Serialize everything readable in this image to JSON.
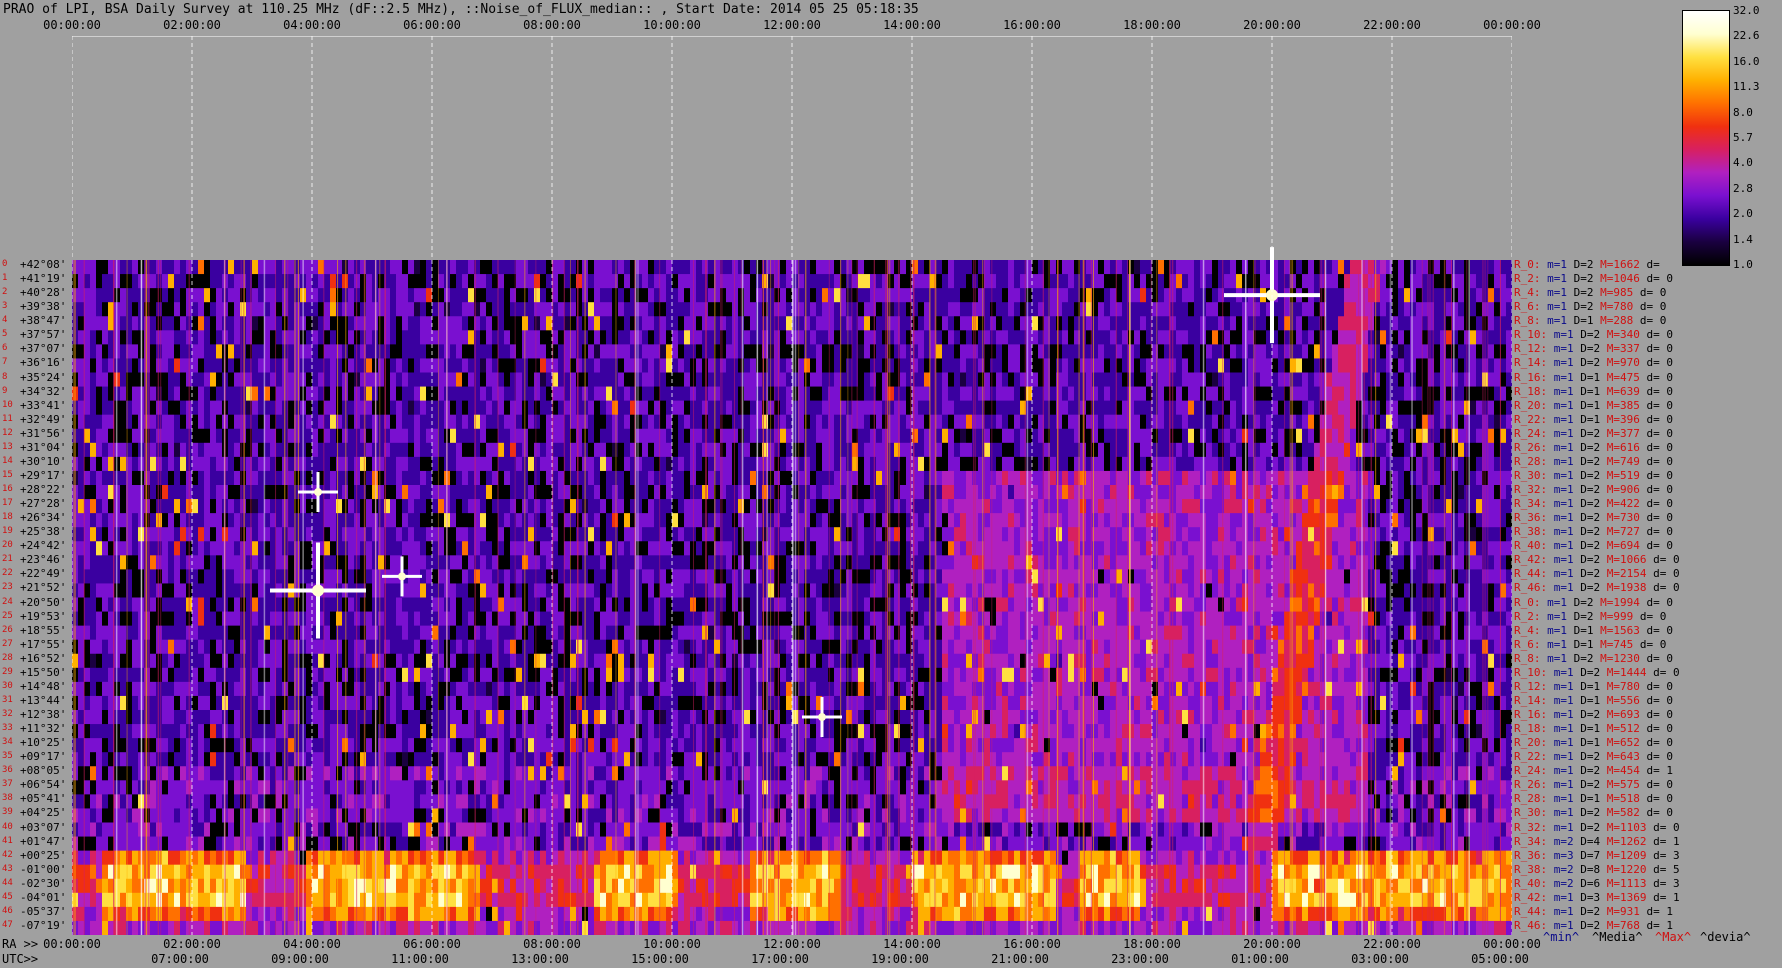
{
  "title": "PRAO of LPI, BSA Daily Survey at 110.25 MHz (dF::2.5 MHz), ::Noise_of_FLUX_median:: , Start Date: 2014 05 25 05:18:35",
  "top_axis_ticks": [
    "00:00:00",
    "02:00:00",
    "04:00:00",
    "06:00:00",
    "08:00:00",
    "10:00:00",
    "12:00:00",
    "14:00:00",
    "16:00:00",
    "18:00:00",
    "20:00:00",
    "22:00:00",
    "00:00:00"
  ],
  "bottom_axis": {
    "ra_label": "RA >>",
    "utc_label": "UTC>>",
    "ra_ticks": [
      "00:00:00",
      "02:00:00",
      "04:00:00",
      "06:00:00",
      "08:00:00",
      "10:00:00",
      "12:00:00",
      "14:00:00",
      "16:00:00",
      "18:00:00",
      "20:00:00",
      "22:00:00",
      "00:00:00"
    ],
    "utc_ticks": [
      "07:00:00",
      "09:00:00",
      "11:00:00",
      "13:00:00",
      "15:00:00",
      "17:00:00",
      "19:00:00",
      "21:00:00",
      "23:00:00",
      "01:00:00",
      "03:00:00",
      "05:00:00"
    ]
  },
  "colorbar": {
    "ticks": [
      "32.0",
      "22.6",
      "16.0",
      "11.3",
      "8.0",
      "5.7",
      "4.0",
      "2.8",
      "2.0",
      "1.4",
      "1.0"
    ],
    "colors": [
      "#000000",
      "#1a0040",
      "#3a00a0",
      "#7a10d0",
      "#b020c0",
      "#d82060",
      "#f03010",
      "#ff7000",
      "#ffb000",
      "#ffe040",
      "#ffffd0",
      "#ffffff"
    ]
  },
  "legend": {
    "min": "^min^",
    "median": "^Media^",
    "max": "^Max^",
    "deviation": "^devia^"
  },
  "dec_labels": [
    "+42°08'",
    "+41°19'",
    "+40°28'",
    "+39°38'",
    "+38°47'",
    "+37°57'",
    "+37°07'",
    "+36°16'",
    "+35°24'",
    "+34°32'",
    "+33°41'",
    "+32°49'",
    "+31°56'",
    "+31°04'",
    "+30°10'",
    "+29°17'",
    "+28°22'",
    "+27°28'",
    "+26°34'",
    "+25°38'",
    "+24°42'",
    "+23°46'",
    "+22°49'",
    "+21°52'",
    "+20°50'",
    "+19°53'",
    "+18°55'",
    "+17°55'",
    "+16°52'",
    "+15°50'",
    "+14°48'",
    "+13°44'",
    "+12°38'",
    "+11°32'",
    "+10°25'",
    "+09°17'",
    "+08°05'",
    "+06°54'",
    "+05°41'",
    "+04°25'",
    "+03°07'",
    "+01°47'",
    "+00°25'",
    "-01°00'",
    "-02°30'",
    "-04°01'",
    "-05°37'",
    "-07°19'"
  ],
  "row_indices": [
    "0",
    "1",
    "2",
    "3",
    "4",
    "5",
    "6",
    "7",
    "8",
    "9",
    "10",
    "11",
    "12",
    "13",
    "14",
    "15",
    "16",
    "17",
    "18",
    "19",
    "20",
    "21",
    "22",
    "23",
    "24",
    "25",
    "26",
    "27",
    "28",
    "29",
    "30",
    "31",
    "32",
    "33",
    "34",
    "35",
    "36",
    "37",
    "38",
    "39",
    "40",
    "41",
    "42",
    "43",
    "44",
    "45",
    "46",
    "47"
  ],
  "beam_stats": [
    {
      "name": "R_0:",
      "min": "m=1",
      "dev": "D=2",
      "max": "M=1662",
      "d": "d="
    },
    {
      "name": "R_2:",
      "min": "m=1",
      "dev": "D=2",
      "max": "M=1046",
      "d": "d= 0"
    },
    {
      "name": "R_4:",
      "min": "m=1",
      "dev": "D=2",
      "max": "M=985",
      "d": "d= 0"
    },
    {
      "name": "R_6:",
      "min": "m=1",
      "dev": "D=2",
      "max": "M=780",
      "d": "d= 0"
    },
    {
      "name": "R_8:",
      "min": "m=1",
      "dev": "D=1",
      "max": "M=288",
      "d": "d= 0"
    },
    {
      "name": "R_10:",
      "min": "m=1",
      "dev": "D=2",
      "max": "M=340",
      "d": "d= 0"
    },
    {
      "name": "R_12:",
      "min": "m=1",
      "dev": "D=2",
      "max": "M=337",
      "d": "d= 0"
    },
    {
      "name": "R_14:",
      "min": "m=1",
      "dev": "D=2",
      "max": "M=970",
      "d": "d= 0"
    },
    {
      "name": "R_16:",
      "min": "m=1",
      "dev": "D=1",
      "max": "M=475",
      "d": "d= 0"
    },
    {
      "name": "R_18:",
      "min": "m=1",
      "dev": "D=1",
      "max": "M=639",
      "d": "d= 0"
    },
    {
      "name": "R_20:",
      "min": "m=1",
      "dev": "D=1",
      "max": "M=385",
      "d": "d= 0"
    },
    {
      "name": "R_22:",
      "min": "m=1",
      "dev": "D=1",
      "max": "M=396",
      "d": "d= 0"
    },
    {
      "name": "R_24:",
      "min": "m=1",
      "dev": "D=2",
      "max": "M=377",
      "d": "d= 0"
    },
    {
      "name": "R_26:",
      "min": "m=1",
      "dev": "D=2",
      "max": "M=616",
      "d": "d= 0"
    },
    {
      "name": "R_28:",
      "min": "m=1",
      "dev": "D=2",
      "max": "M=749",
      "d": "d= 0"
    },
    {
      "name": "R_30:",
      "min": "m=1",
      "dev": "D=2",
      "max": "M=519",
      "d": "d= 0"
    },
    {
      "name": "R_32:",
      "min": "m=1",
      "dev": "D=2",
      "max": "M=906",
      "d": "d= 0"
    },
    {
      "name": "R_34:",
      "min": "m=1",
      "dev": "D=2",
      "max": "M=422",
      "d": "d= 0"
    },
    {
      "name": "R_36:",
      "min": "m=1",
      "dev": "D=2",
      "max": "M=730",
      "d": "d= 0"
    },
    {
      "name": "R_38:",
      "min": "m=1",
      "dev": "D=2",
      "max": "M=727",
      "d": "d= 0"
    },
    {
      "name": "R_40:",
      "min": "m=1",
      "dev": "D=2",
      "max": "M=694",
      "d": "d= 0"
    },
    {
      "name": "R_42:",
      "min": "m=1",
      "dev": "D=2",
      "max": "M=1066",
      "d": "d= 0"
    },
    {
      "name": "R_44:",
      "min": "m=1",
      "dev": "D=2",
      "max": "M=2154",
      "d": "d= 0"
    },
    {
      "name": "R_46:",
      "min": "m=1",
      "dev": "D=2",
      "max": "M=1938",
      "d": "d= 0"
    },
    {
      "name": "R_0:",
      "min": "m=1",
      "dev": "D=2",
      "max": "M=1994",
      "d": "d= 0"
    },
    {
      "name": "R_2:",
      "min": "m=1",
      "dev": "D=2",
      "max": "M=999",
      "d": "d= 0"
    },
    {
      "name": "R_4:",
      "min": "m=1",
      "dev": "D=1",
      "max": "M=1563",
      "d": "d= 0"
    },
    {
      "name": "R_6:",
      "min": "m=1",
      "dev": "D=1",
      "max": "M=745",
      "d": "d= 0"
    },
    {
      "name": "R_8:",
      "min": "m=1",
      "dev": "D=2",
      "max": "M=1230",
      "d": "d= 0"
    },
    {
      "name": "R_10:",
      "min": "m=1",
      "dev": "D=2",
      "max": "M=1444",
      "d": "d= 0"
    },
    {
      "name": "R_12:",
      "min": "m=1",
      "dev": "D=1",
      "max": "M=780",
      "d": "d= 0"
    },
    {
      "name": "R_14:",
      "min": "m=1",
      "dev": "D=1",
      "max": "M=556",
      "d": "d= 0"
    },
    {
      "name": "R_16:",
      "min": "m=1",
      "dev": "D=2",
      "max": "M=693",
      "d": "d= 0"
    },
    {
      "name": "R_18:",
      "min": "m=1",
      "dev": "D=1",
      "max": "M=512",
      "d": "d= 0"
    },
    {
      "name": "R_20:",
      "min": "m=1",
      "dev": "D=1",
      "max": "M=652",
      "d": "d= 0"
    },
    {
      "name": "R_22:",
      "min": "m=1",
      "dev": "D=2",
      "max": "M=643",
      "d": "d= 0"
    },
    {
      "name": "R_24:",
      "min": "m=1",
      "dev": "D=2",
      "max": "M=454",
      "d": "d= 1"
    },
    {
      "name": "R_26:",
      "min": "m=1",
      "dev": "D=2",
      "max": "M=575",
      "d": "d= 0"
    },
    {
      "name": "R_28:",
      "min": "m=1",
      "dev": "D=1",
      "max": "M=518",
      "d": "d= 0"
    },
    {
      "name": "R_30:",
      "min": "m=1",
      "dev": "D=2",
      "max": "M=582",
      "d": "d= 0"
    },
    {
      "name": "R_32:",
      "min": "m=1",
      "dev": "D=2",
      "max": "M=1103",
      "d": "d= 0"
    },
    {
      "name": "R_34:",
      "min": "m=2",
      "dev": "D=4",
      "max": "M=1262",
      "d": "d= 1"
    },
    {
      "name": "R_36:",
      "min": "m=3",
      "dev": "D=7",
      "max": "M=1209",
      "d": "d= 3"
    },
    {
      "name": "R_38:",
      "min": "m=2",
      "dev": "D=8",
      "max": "M=1220",
      "d": "d= 5"
    },
    {
      "name": "R_40:",
      "min": "m=2",
      "dev": "D=6",
      "max": "M=1113",
      "d": "d= 3"
    },
    {
      "name": "R_42:",
      "min": "m=1",
      "dev": "D=3",
      "max": "M=1369",
      "d": "d= 1"
    },
    {
      "name": "R_44:",
      "min": "m=1",
      "dev": "D=2",
      "max": "M=931",
      "d": "d= 1"
    },
    {
      "name": "R_46:",
      "min": "m=1",
      "dev": "D=2",
      "max": "M=768",
      "d": "d= 1"
    }
  ],
  "chart_data": {
    "type": "heatmap",
    "title": "PRAO of LPI, BSA Daily Survey at 110.25 MHz (dF::2.5 MHz), ::Noise_of_FLUX_median:: , Start Date: 2014 05 25 05:18:35",
    "x_axis_ra": [
      "00:00:00",
      "02:00:00",
      "04:00:00",
      "06:00:00",
      "08:00:00",
      "10:00:00",
      "12:00:00",
      "14:00:00",
      "16:00:00",
      "18:00:00",
      "20:00:00",
      "22:00:00",
      "00:00:00"
    ],
    "x_axis_utc": [
      "07:00:00",
      "09:00:00",
      "11:00:00",
      "13:00:00",
      "15:00:00",
      "17:00:00",
      "19:00:00",
      "21:00:00",
      "23:00:00",
      "01:00:00",
      "03:00:00",
      "05:00:00"
    ],
    "y_axis_dec": [
      "+42°08'",
      "+41°19'",
      "+40°28'",
      "+39°38'",
      "+38°47'",
      "+37°57'",
      "+37°07'",
      "+36°16'",
      "+35°24'",
      "+34°32'",
      "+33°41'",
      "+32°49'",
      "+31°56'",
      "+31°04'",
      "+30°10'",
      "+29°17'",
      "+28°22'",
      "+27°28'",
      "+26°34'",
      "+25°38'",
      "+24°42'",
      "+23°46'",
      "+22°49'",
      "+21°52'",
      "+20°50'",
      "+19°53'",
      "+18°55'",
      "+17°55'",
      "+16°52'",
      "+15°50'",
      "+14°48'",
      "+13°44'",
      "+12°38'",
      "+11°32'",
      "+10°25'",
      "+09°17'",
      "+08°05'",
      "+06°54'",
      "+05°41'",
      "+04°25'",
      "+03°07'",
      "+01°47'",
      "+00°25'",
      "-01°00'",
      "-02°30'",
      "-04°01'",
      "-05°37'",
      "-07°19'"
    ],
    "colorbar_ticks": [
      32.0,
      22.6,
      16.0,
      11.3,
      8.0,
      5.7,
      4.0,
      2.8,
      2.0,
      1.4,
      1.0
    ],
    "colorbar_scale": "log",
    "grid": true,
    "bright_sources": [
      {
        "ra_hours": 4.1,
        "dec": "+21°52'",
        "level": "saturated"
      },
      {
        "ra_hours": 20.0,
        "dec": "+40°28'",
        "level": "saturated"
      },
      {
        "ra_hours": 4.1,
        "dec": "+28°22'",
        "level": "high"
      },
      {
        "ra_hours": 5.5,
        "dec": "+22°49'",
        "level": "high"
      },
      {
        "ra_hours": 12.5,
        "dec": "+12°38'",
        "level": "high"
      }
    ],
    "bright_band_decs": [
      "+01°47'",
      "+00°25'",
      "-01°00'",
      "-02°30'",
      "-04°01'"
    ]
  }
}
